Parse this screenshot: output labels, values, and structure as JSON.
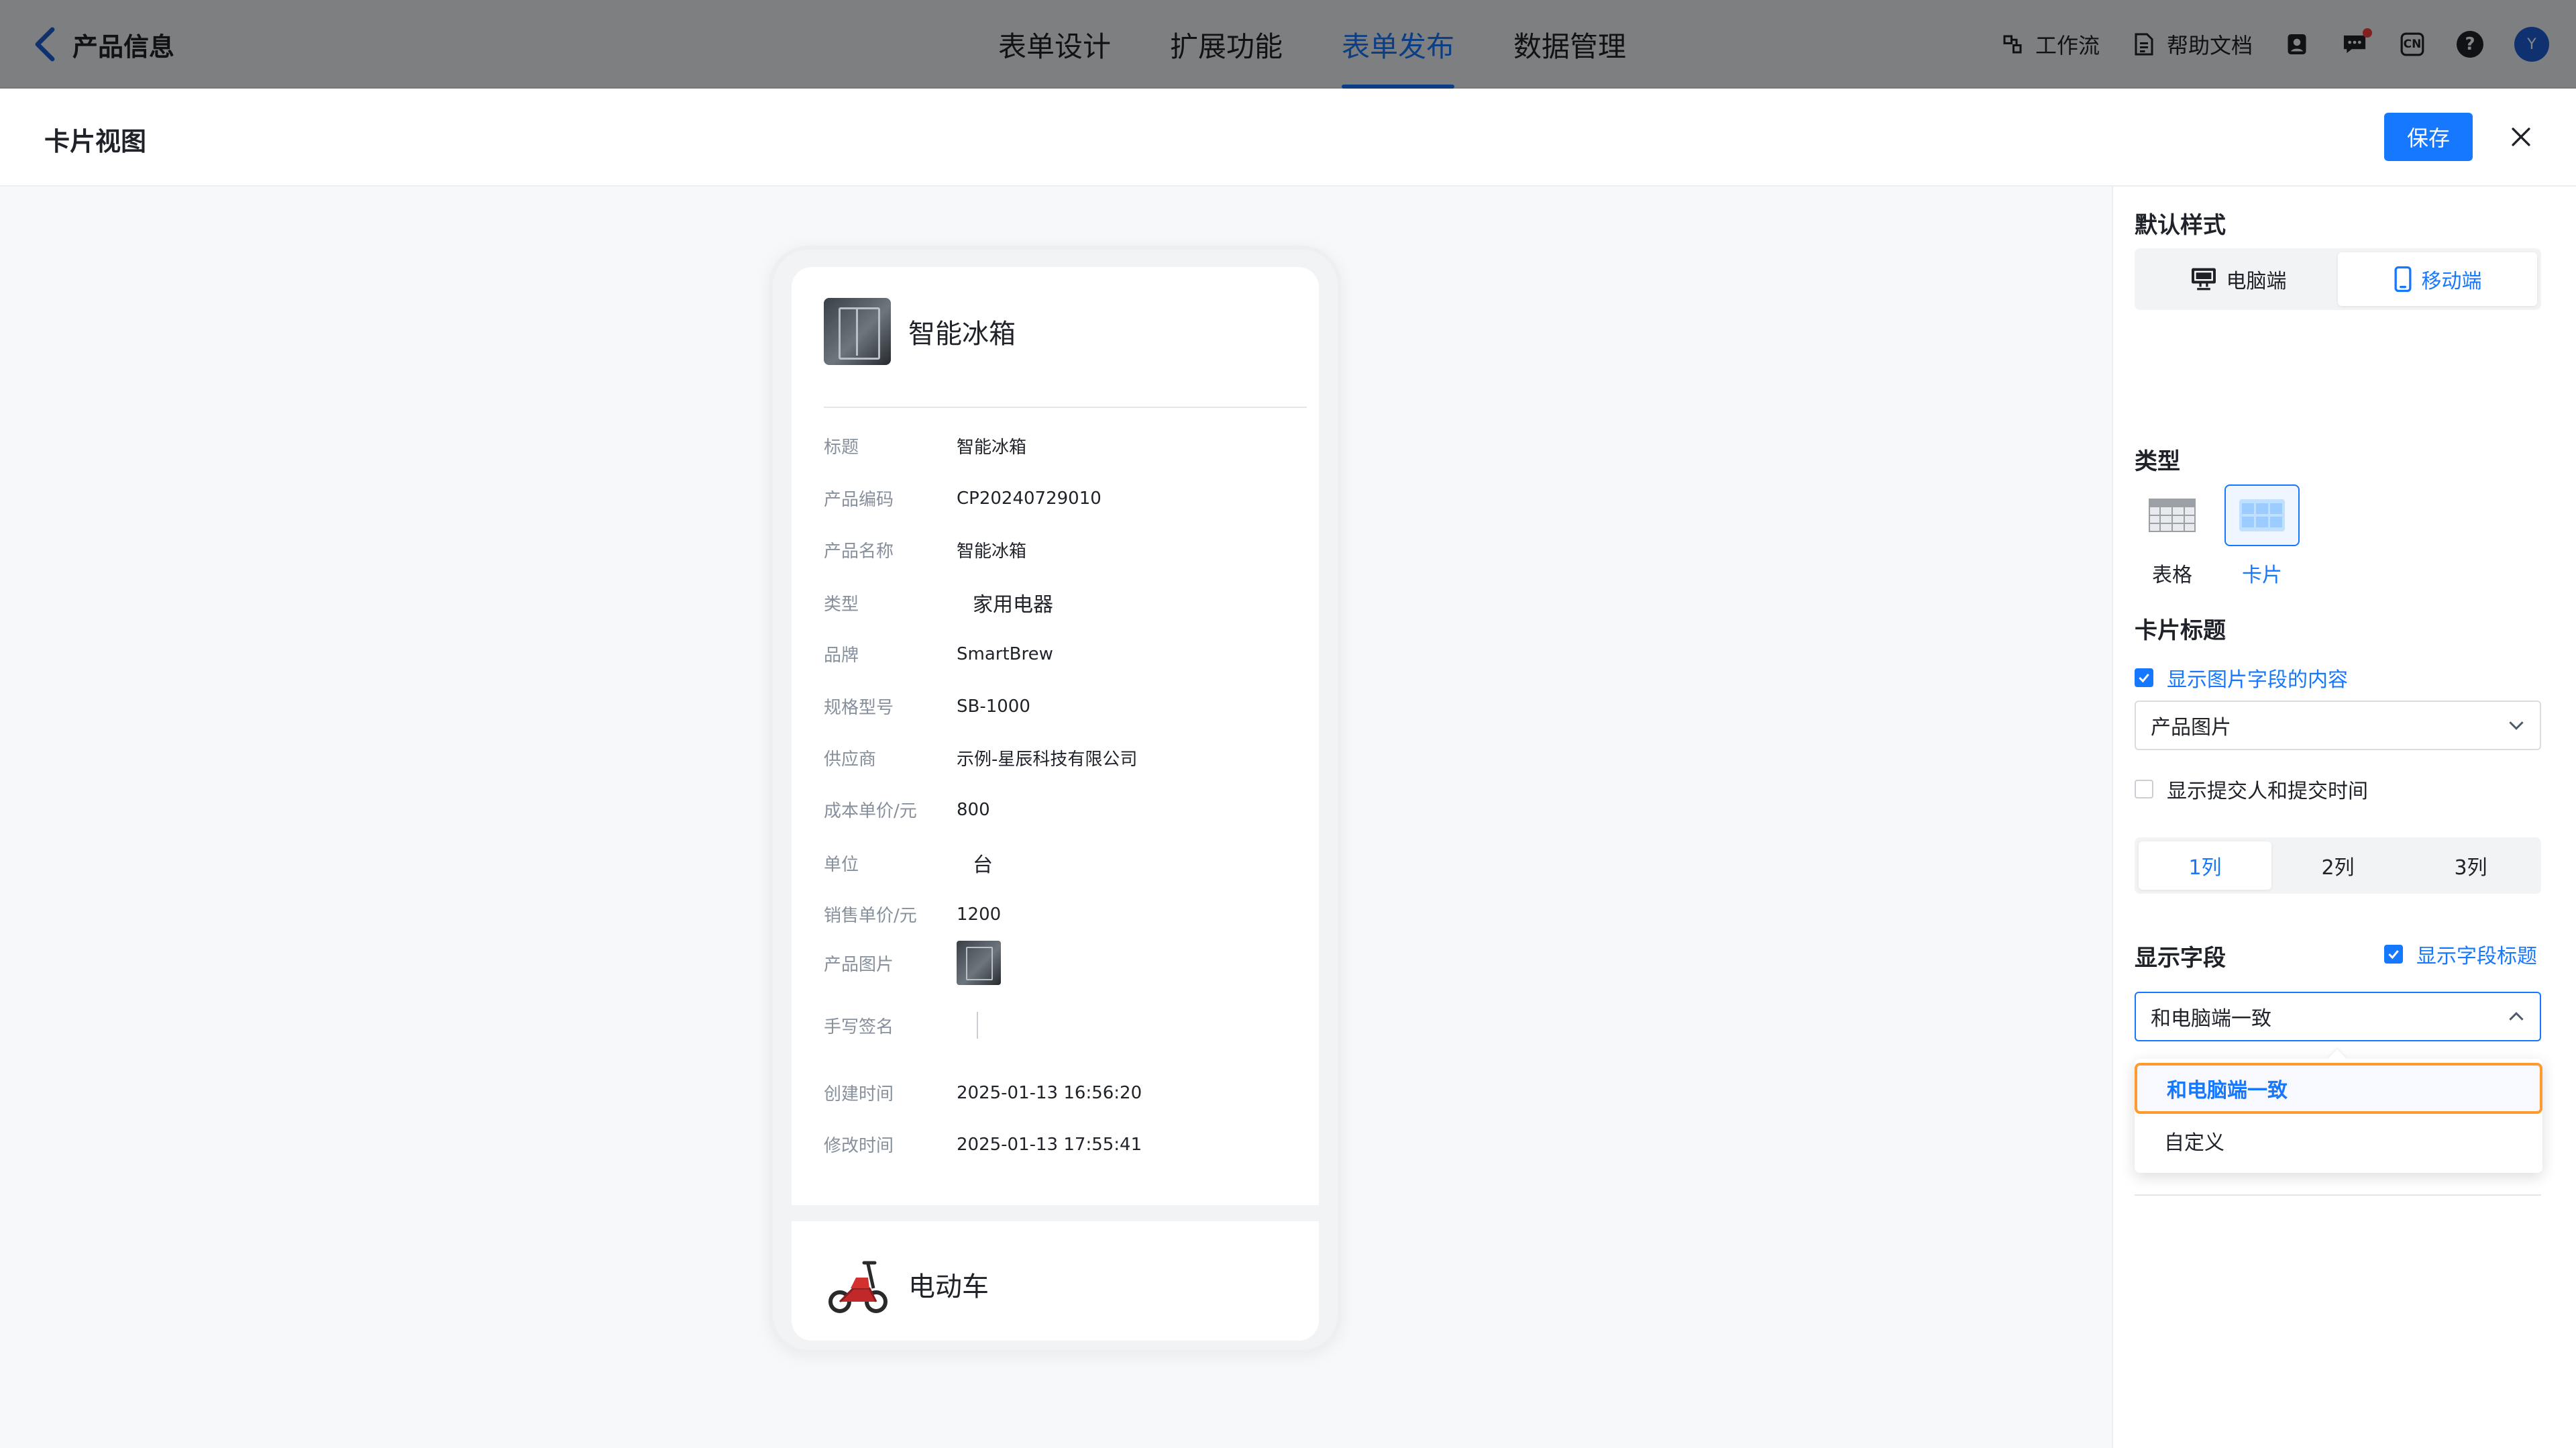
{
  "topbar": {
    "app_title": "产品信息",
    "tabs": [
      {
        "label": "表单设计",
        "active": false
      },
      {
        "label": "扩展功能",
        "active": false
      },
      {
        "label": "表单发布",
        "active": true
      },
      {
        "label": "数据管理",
        "active": false
      }
    ],
    "tools": {
      "workflow": "工作流",
      "help_docs": "帮助文档",
      "lang": "CN",
      "help": "?",
      "avatar": "Y"
    }
  },
  "modal": {
    "title": "卡片视图",
    "save_label": "保存"
  },
  "preview": {
    "card1": {
      "title": "智能冰箱",
      "fields": [
        {
          "label": "标题",
          "value": "智能冰箱",
          "kind": "text"
        },
        {
          "label": "产品编码",
          "value": "CP20240729010",
          "kind": "text"
        },
        {
          "label": "产品名称",
          "value": "智能冰箱",
          "kind": "text"
        },
        {
          "label": "类型",
          "value": "家用电器",
          "kind": "big"
        },
        {
          "label": "品牌",
          "value": "SmartBrew",
          "kind": "text"
        },
        {
          "label": "规格型号",
          "value": "SB-1000",
          "kind": "text"
        },
        {
          "label": "供应商",
          "value": "示例-星辰科技有限公司",
          "kind": "text"
        },
        {
          "label": "成本单价/元",
          "value": "800",
          "kind": "text"
        },
        {
          "label": "单位",
          "value": "台",
          "kind": "big"
        },
        {
          "label": "销售单价/元",
          "value": "1200",
          "kind": "text"
        },
        {
          "label": "产品图片",
          "value": "",
          "kind": "image"
        },
        {
          "label": "手写签名",
          "value": "",
          "kind": "signature"
        },
        {
          "label": "创建时间",
          "value": "2025-01-13 16:56:20",
          "kind": "text"
        },
        {
          "label": "修改时间",
          "value": "2025-01-13 17:55:41",
          "kind": "text"
        }
      ]
    },
    "card2": {
      "title": "电动车"
    }
  },
  "panel": {
    "default_style": {
      "title": "默认样式",
      "options": [
        {
          "label": "电脑端",
          "icon": "desktop-icon",
          "active": false
        },
        {
          "label": "移动端",
          "icon": "mobile-icon",
          "active": true
        }
      ]
    },
    "type": {
      "title": "类型",
      "options": [
        {
          "label": "表格",
          "active": false
        },
        {
          "label": "卡片",
          "active": true
        }
      ]
    },
    "card_title": {
      "title": "卡片标题",
      "show_image_label": "显示图片字段的内容",
      "show_image_checked": true,
      "image_field": "产品图片",
      "show_submitter_label": "显示提交人和提交时间",
      "show_submitter_checked": false
    },
    "columns": [
      {
        "label": "1列",
        "active": true
      },
      {
        "label": "2列",
        "active": false
      },
      {
        "label": "3列",
        "active": false
      }
    ],
    "display_fields": {
      "title": "显示字段",
      "show_field_title_label": "显示字段标题",
      "show_field_title_checked": true,
      "selected": "和电脑端一致",
      "options": [
        "和电脑端一致",
        "自定义"
      ]
    }
  },
  "colors": {
    "accent": "#1677ff",
    "highlight": "#ff9a2e"
  }
}
